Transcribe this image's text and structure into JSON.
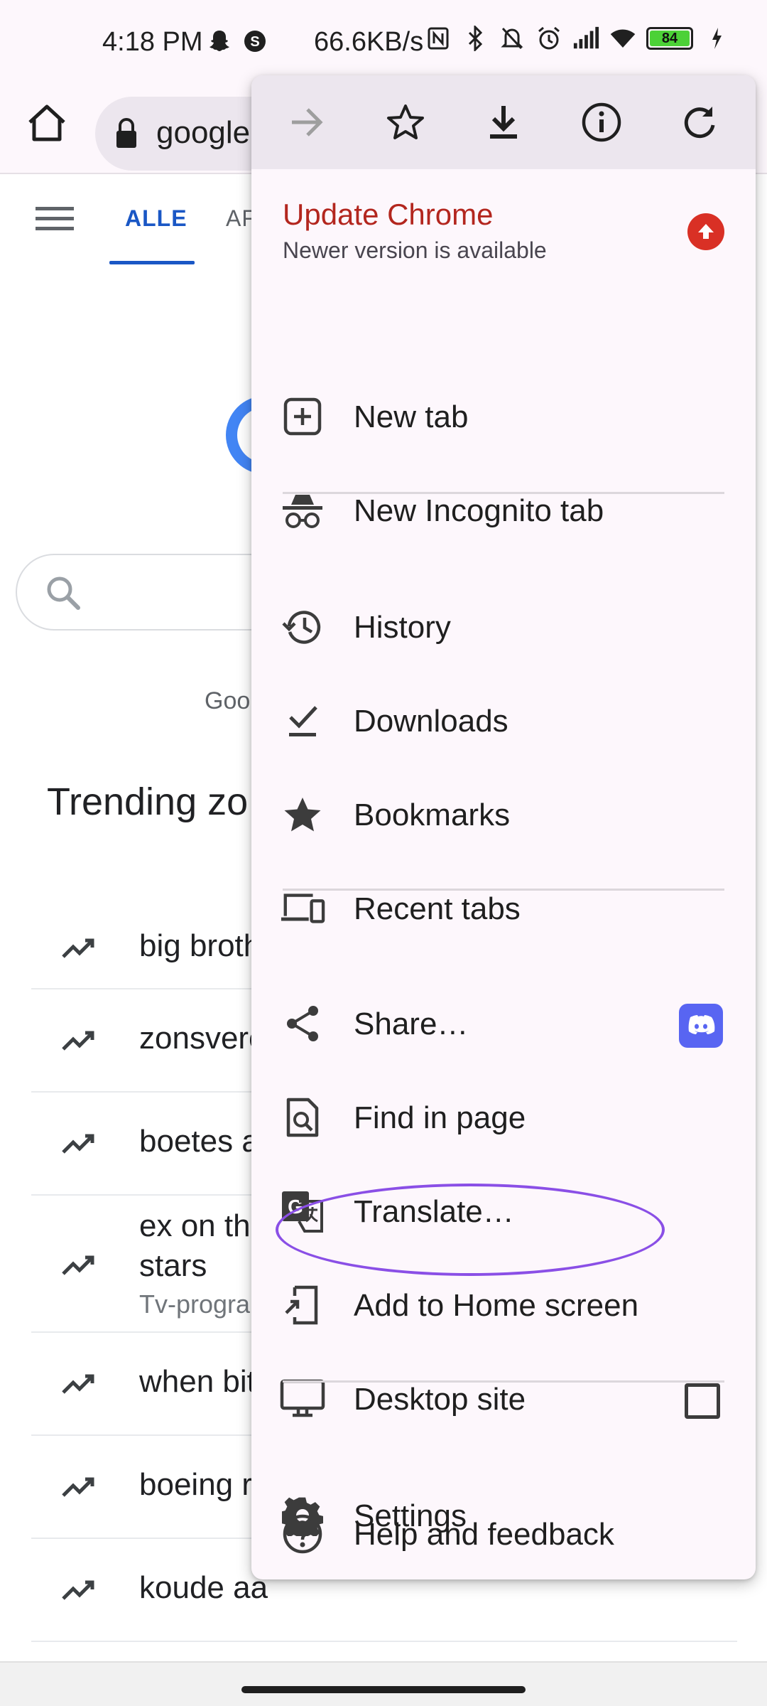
{
  "status_bar": {
    "time": "4:18 PM",
    "speed": "66.6KB/s",
    "battery": "84"
  },
  "toolbar": {
    "url": "google"
  },
  "page": {
    "tabs": [
      "ALLE",
      "AF"
    ],
    "google_small_text": "Goo",
    "trending_title": "Trending zo",
    "trending": [
      {
        "label": "big broth",
        "sub": ""
      },
      {
        "label": "zonsvere",
        "sub": ""
      },
      {
        "label": "boetes a",
        "sub": ""
      },
      {
        "label": "ex on the",
        "label2": "stars",
        "sub": "Tv-progra"
      },
      {
        "label": "when bit",
        "sub": ""
      },
      {
        "label": "boeing r",
        "sub": ""
      },
      {
        "label": "koude aa",
        "sub": ""
      }
    ]
  },
  "menu": {
    "top_icons": [
      "forward-icon",
      "star-icon",
      "download-icon",
      "info-icon",
      "reload-icon"
    ],
    "update": {
      "title": "Update Chrome",
      "subtitle": "Newer version is available",
      "badge_color": "#d93025"
    },
    "items": [
      {
        "id": "new-tab",
        "label": "New tab",
        "icon": "plus-box-icon"
      },
      {
        "id": "new-incognito-tab",
        "label": "New Incognito tab",
        "icon": "incognito-icon"
      },
      {
        "id": "history",
        "label": "History",
        "icon": "history-icon"
      },
      {
        "id": "downloads",
        "label": "Downloads",
        "icon": "download-check-icon"
      },
      {
        "id": "bookmarks",
        "label": "Bookmarks",
        "icon": "star-filled-icon"
      },
      {
        "id": "recent-tabs",
        "label": "Recent tabs",
        "icon": "devices-icon"
      },
      {
        "id": "share",
        "label": "Share…",
        "icon": "share-icon"
      },
      {
        "id": "find-in-page",
        "label": "Find in page",
        "icon": "find-in-page-icon"
      },
      {
        "id": "translate",
        "label": "Translate…",
        "icon": "translate-icon"
      },
      {
        "id": "add-to-home-screen",
        "label": "Add to Home screen",
        "icon": "add-to-home-icon"
      },
      {
        "id": "desktop-site",
        "label": "Desktop site",
        "icon": "monitor-icon",
        "checked": false
      },
      {
        "id": "settings",
        "label": "Settings",
        "icon": "gear-icon"
      },
      {
        "id": "help-feedback",
        "label": "Help and feedback",
        "icon": "help-icon"
      }
    ],
    "accent_highlight_color": "#8a4fe6"
  }
}
